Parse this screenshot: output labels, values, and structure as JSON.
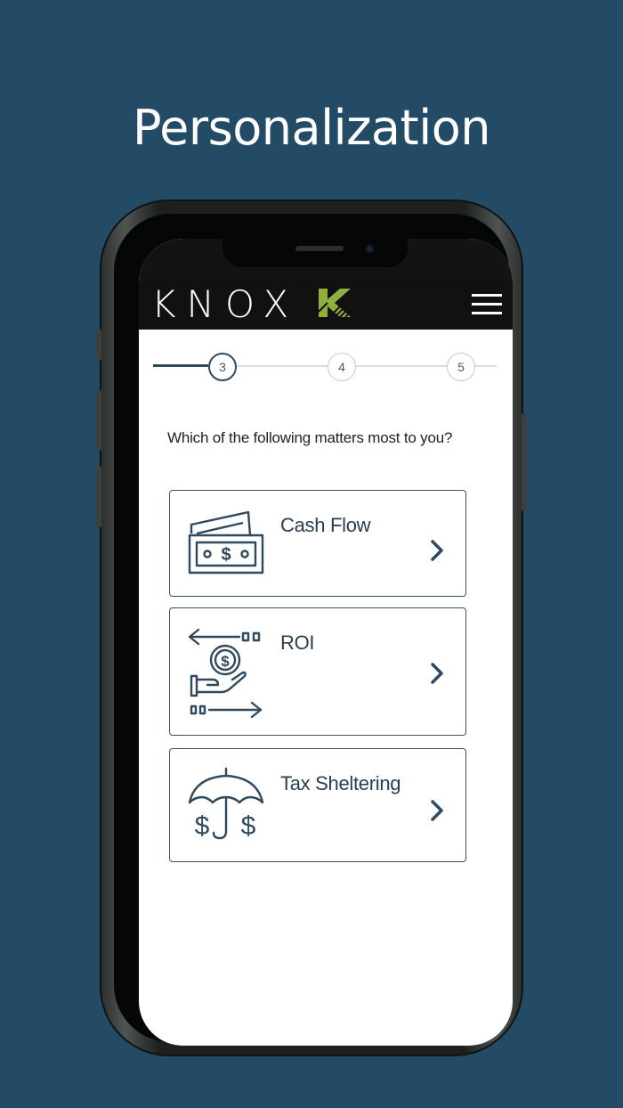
{
  "headline": "Personalization",
  "app": {
    "brand": "KNOX"
  },
  "stepper": {
    "steps": [
      "3",
      "4",
      "5"
    ],
    "active_step": "3"
  },
  "question": "Which of the following matters most to you?",
  "options": [
    {
      "label": "Cash Flow",
      "icon": "cash-icon"
    },
    {
      "label": "ROI",
      "icon": "roi-icon"
    },
    {
      "label": "Tax Sheltering",
      "icon": "umbrella-icon"
    }
  ],
  "colors": {
    "background": "#234b65",
    "navy": "#2f4a5e",
    "header": "#111111",
    "brand_green": "#8faf3c"
  }
}
